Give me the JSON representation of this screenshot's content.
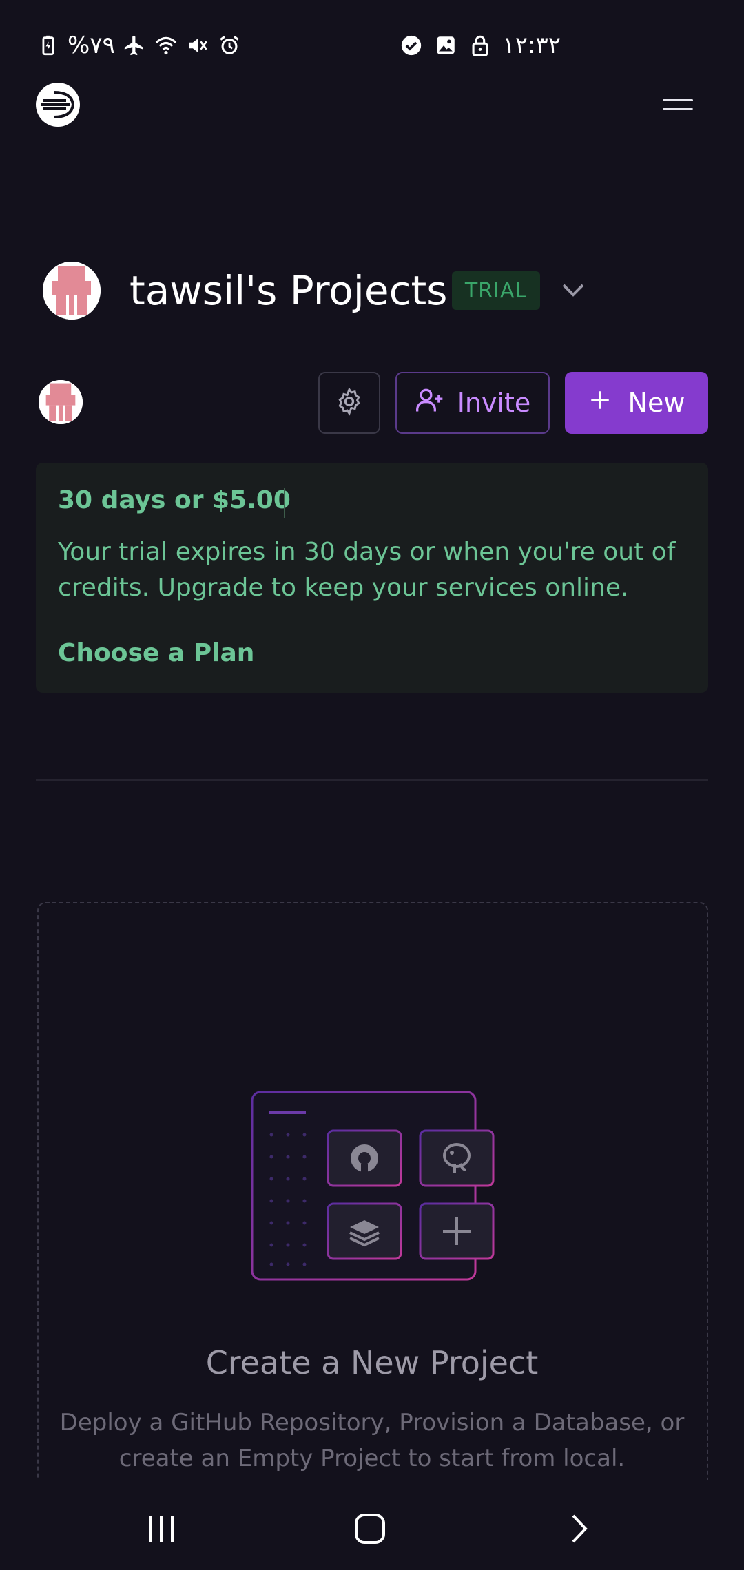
{
  "status_bar": {
    "battery": "%۷۹",
    "time": "۱۲:۳۲",
    "left_icons": [
      "battery-icon",
      "airplane-icon",
      "wifi-icon",
      "mute-icon",
      "alarm-icon"
    ],
    "right_icons": [
      "check-circle-icon",
      "image-icon",
      "lock-icon"
    ]
  },
  "header": {
    "logo_icon": "railway-logo-icon",
    "menu_icon": "menu-icon"
  },
  "project": {
    "title": "tawsil's Projects",
    "badge": "TRIAL",
    "dropdown_icon": "chevron-down-icon"
  },
  "toolbar": {
    "settings_icon": "gear-icon",
    "invite_label": "Invite",
    "invite_icon": "user-plus-icon",
    "new_label": "New",
    "new_icon": "plus-icon"
  },
  "trial_card": {
    "amount": "30 days or $5.00",
    "description": "Your trial expires in 30 days or when you're out of credits. Upgrade to keep your services online.",
    "cta": "Choose a Plan"
  },
  "empty_state": {
    "illustration_icons": [
      "github-icon",
      "postgres-icon",
      "redis-layers-icon",
      "plus-icon"
    ],
    "title": "Create a New Project",
    "description": "Deploy a GitHub Repository, Provision a Database, or create an Empty Project to start from local."
  },
  "nav_bar": {
    "icons": [
      "recent-apps-icon",
      "home-icon",
      "back-icon"
    ]
  },
  "colors": {
    "background": "#13111c",
    "accent": "#853bce",
    "trial_text": "#6cc596",
    "trial_bg": "#191d1e"
  }
}
